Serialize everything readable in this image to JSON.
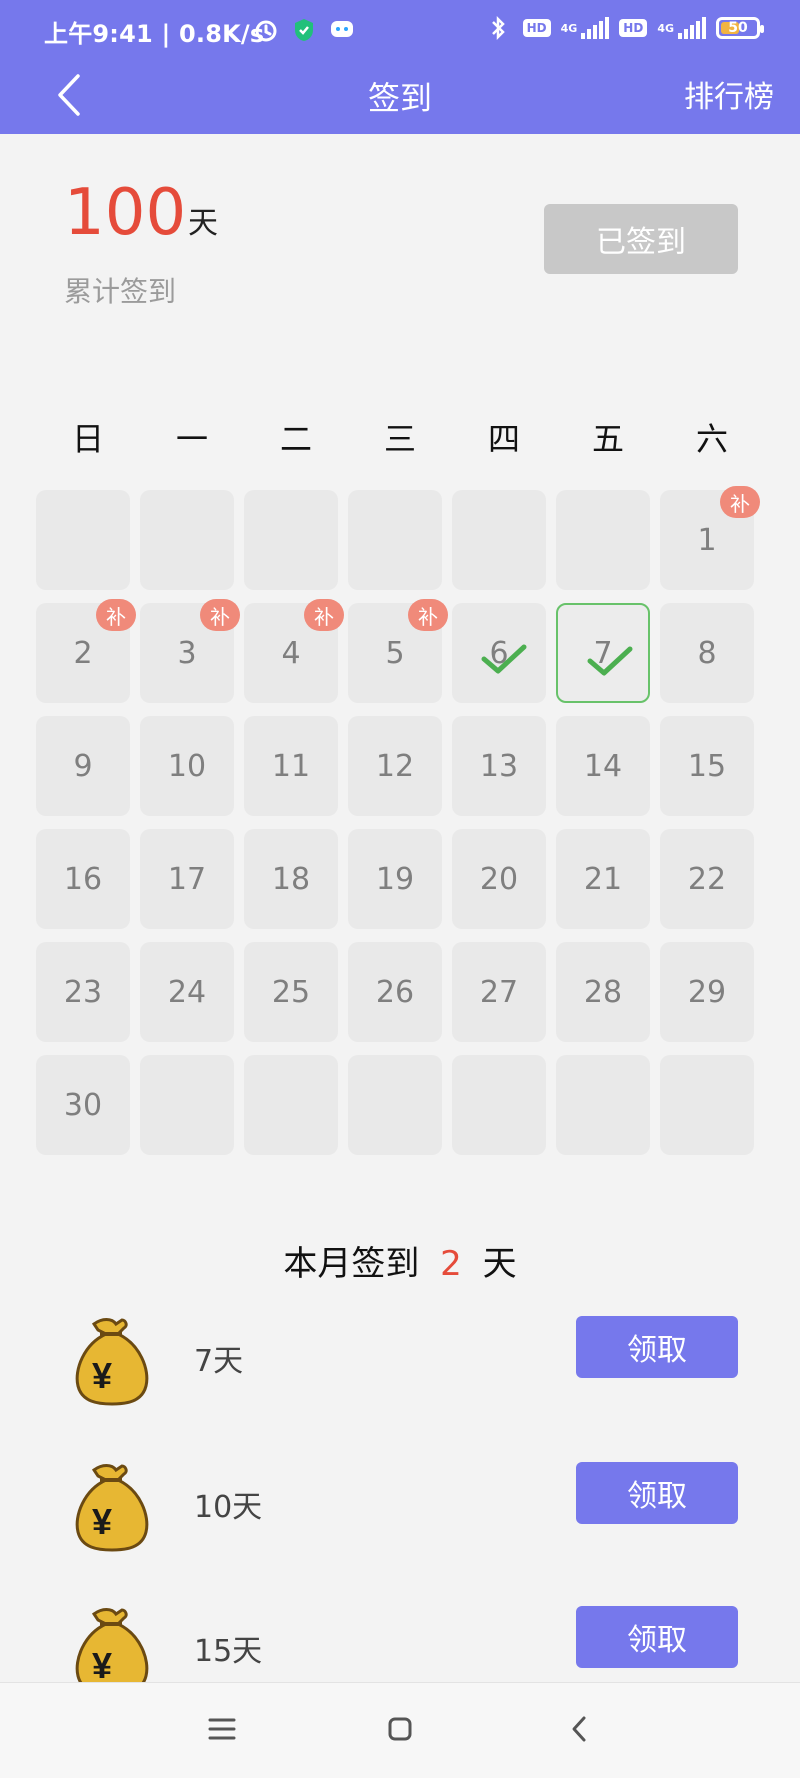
{
  "status_bar": {
    "time_speed": "上午9:41 | 0.8K/s",
    "hd1": "HD",
    "hd2": "HD",
    "net1": "4G",
    "net2": "4G",
    "battery": "50"
  },
  "header": {
    "title": "签到",
    "rank": "排行榜"
  },
  "summary": {
    "total_days": "100",
    "unit": "天",
    "label": "累计签到",
    "signed_button": "已签到"
  },
  "weekdays": [
    "日",
    "一",
    "二",
    "三",
    "四",
    "五",
    "六"
  ],
  "calendar": {
    "makeup_label": "补",
    "weeks": [
      [
        "",
        "",
        "",
        "",
        "",
        "",
        "1"
      ],
      [
        "2",
        "3",
        "4",
        "5",
        "6",
        "7",
        "8"
      ],
      [
        "9",
        "10",
        "11",
        "12",
        "13",
        "14",
        "15"
      ],
      [
        "16",
        "17",
        "18",
        "19",
        "20",
        "21",
        "22"
      ],
      [
        "23",
        "24",
        "25",
        "26",
        "27",
        "28",
        "29"
      ],
      [
        "30",
        "",
        "",
        "",
        "",
        "",
        ""
      ]
    ],
    "makeup_days": [
      "1",
      "2",
      "3",
      "4",
      "5"
    ],
    "checked_days": [
      "6",
      "7"
    ],
    "today": "7"
  },
  "month": {
    "prefix": "本月签到",
    "count": "2",
    "suffix": "天"
  },
  "rewards": [
    {
      "label": "7天",
      "button": "领取"
    },
    {
      "label": "10天",
      "button": "领取"
    },
    {
      "label": "15天",
      "button": "领取"
    }
  ],
  "colors": {
    "brand": "#7678ec",
    "accent_red": "#e54b3a",
    "check_green": "#4caf50",
    "badge": "#f08a7a"
  }
}
